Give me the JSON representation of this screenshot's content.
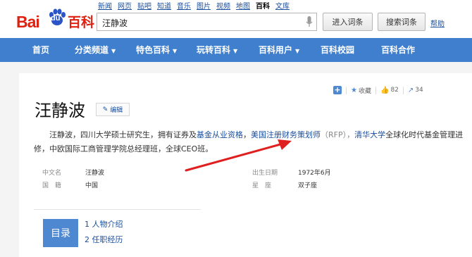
{
  "header": {
    "logo": {
      "part1": "Bai",
      "part2": "du",
      "part3": "百科"
    },
    "top_links": [
      "新闻",
      "网页",
      "贴吧",
      "知道",
      "音乐",
      "图片",
      "视频",
      "地图",
      "百科",
      "文库"
    ],
    "active_link": "百科",
    "search_value": "汪静波",
    "enter_button": "进入词条",
    "search_button": "搜索词条",
    "help": "帮助"
  },
  "nav": {
    "items": [
      {
        "label": "首页",
        "caret": ""
      },
      {
        "label": "分类频道",
        "caret": "▼"
      },
      {
        "label": "特色百科",
        "caret": "▼"
      },
      {
        "label": "玩转百科",
        "caret": "▼"
      },
      {
        "label": "百科用户",
        "caret": "▼"
      },
      {
        "label": "百科校园",
        "caret": ""
      },
      {
        "label": "百科合作",
        "caret": ""
      }
    ]
  },
  "actions": {
    "plus": "+",
    "favorite": "收藏",
    "likes": "82",
    "shares": "34"
  },
  "entry": {
    "title": "汪静波",
    "edit": "编辑",
    "summary": {
      "p1": "汪静波，四川大学硕士研究生，拥有证券及",
      "link1": "基金从业资格",
      "p2": "，",
      "link2": "美国注册财务策划师",
      "p3": "（RFP），",
      "link3": "清华大学",
      "p4": "全球化时代基金管理进修，中欧国际工商管理学院总经理班，全球CEO班。"
    },
    "info": {
      "k1": "中文名",
      "v1": "汪静波",
      "k2": "国　籍",
      "v2": "中国",
      "k3": "出生日期",
      "v3": "1972年6月",
      "k4": "星　座",
      "v4": "双子座"
    },
    "toc": {
      "label": "目录",
      "items": [
        "1  人物介绍",
        "2  任职经历"
      ]
    }
  },
  "colors": {
    "brand_red": "#de2110",
    "nav_blue": "#3f7fcd",
    "link_blue": "#1a4fa0",
    "arrow_red": "#e02020"
  }
}
